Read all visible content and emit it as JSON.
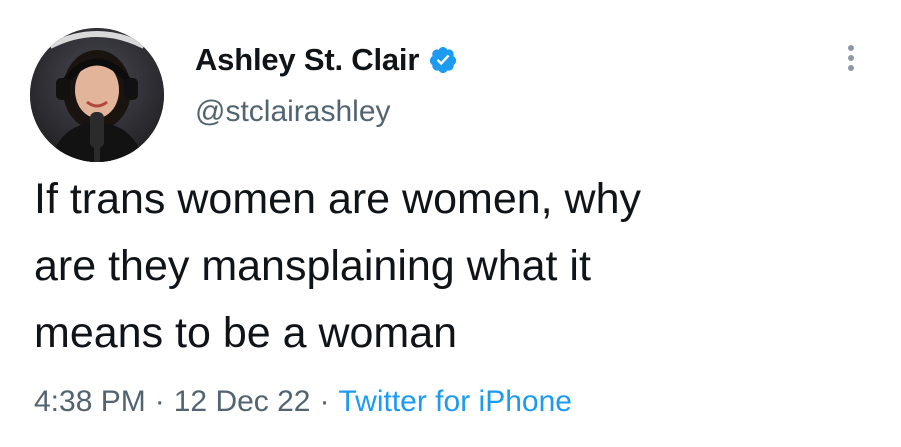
{
  "author": {
    "display_name": "Ashley St. Clair",
    "handle": "@stclairashley",
    "verified": true,
    "avatar_alt": "profile photo"
  },
  "tweet": {
    "text": "If trans women are women, why\nare they mansplaining what it\nmeans to be a woman",
    "time": "4:38 PM",
    "date": "12 Dec 22",
    "separator": "·",
    "source": "Twitter for iPhone"
  },
  "icons": {
    "verified": "verified-badge-icon",
    "more": "more-options-icon"
  },
  "colors": {
    "text_primary": "#0f1419",
    "text_secondary": "#536471",
    "accent": "#1d9bf0"
  }
}
